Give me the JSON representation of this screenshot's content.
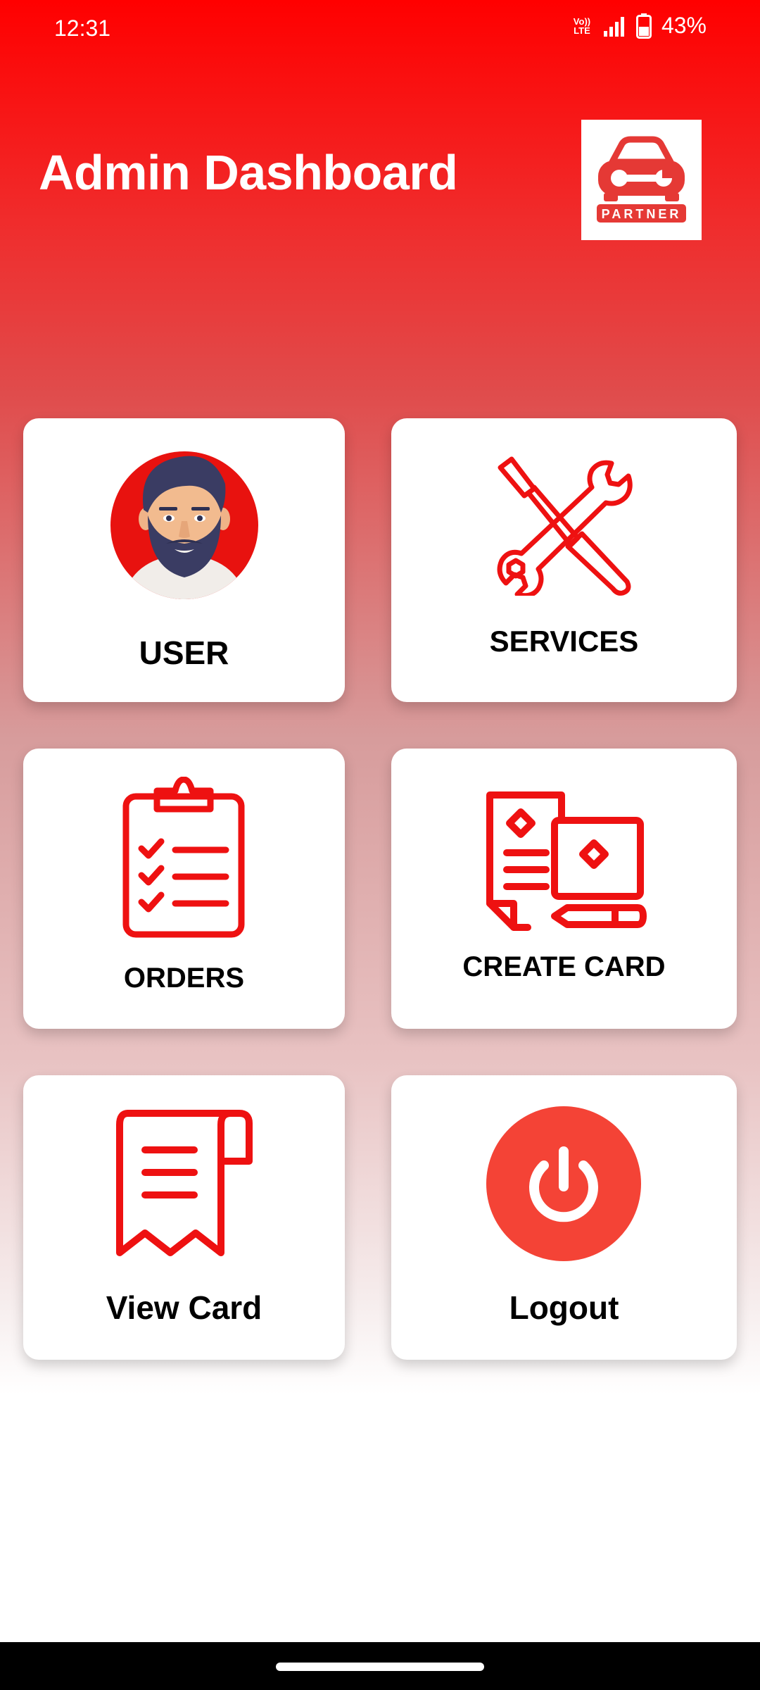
{
  "status_bar": {
    "time": "12:31",
    "network_badge_top": "Vo))",
    "network_badge_bottom": "LTE",
    "battery_percent": "43%",
    "icons": [
      "volte-icon",
      "signal-icon",
      "battery-icon"
    ]
  },
  "header": {
    "title": "Admin Dashboard",
    "logo_text": "PARTNER",
    "logo_icon": "car-wrench-logo"
  },
  "tiles": [
    {
      "label": "USER",
      "icon": "user-avatar-icon"
    },
    {
      "label": "SERVICES",
      "icon": "tools-icon"
    },
    {
      "label": "ORDERS",
      "icon": "clipboard-checklist-icon"
    },
    {
      "label": "CREATE CARD",
      "icon": "create-card-icon"
    },
    {
      "label": "View Card",
      "icon": "receipt-icon"
    },
    {
      "label": "Logout",
      "icon": "power-icon"
    }
  ],
  "colors": {
    "accent": "#ff0000",
    "icon_red": "#ee1111",
    "logout_circle": "#f44336",
    "logo_red": "#e53935"
  }
}
